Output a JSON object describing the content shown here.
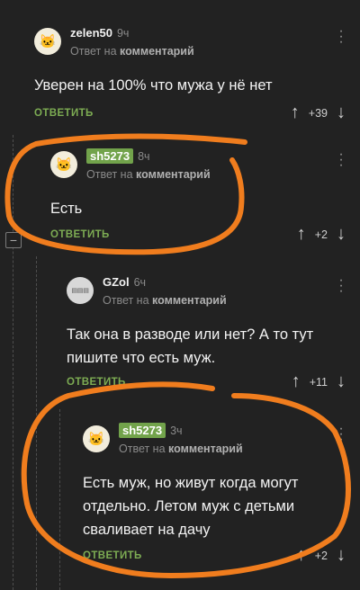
{
  "comments": [
    {
      "username": "zelen50",
      "time": "9ч",
      "reply_prefix": "Ответ на",
      "reply_target": "комментарий",
      "text": "Уверен на 100% что мужа у нё нет",
      "reply_label": "ОТВЕТИТЬ",
      "votes": "+39"
    },
    {
      "username": "sh5273",
      "time": "8ч",
      "reply_prefix": "Ответ на",
      "reply_target": "комментарий",
      "text": "Есть",
      "reply_label": "ОТВЕТИТЬ",
      "votes": "+2"
    },
    {
      "username": "GZol",
      "time": "6ч",
      "reply_prefix": "Ответ на",
      "reply_target": "комментарий",
      "text": "Так она в разводе или нет? А то тут пишите что есть муж.",
      "reply_label": "ОТВЕТИТЬ",
      "votes": "+11"
    },
    {
      "username": "sh5273",
      "time": "3ч",
      "reply_prefix": "Ответ на",
      "reply_target": "комментарий",
      "text": "Есть муж, но живут когда могут отдельно. Летом муж с детьми сваливает на дачу",
      "reply_label": "ОТВЕТИТЬ",
      "votes": "+2"
    }
  ],
  "icons": {
    "more": "vertical-ellipsis",
    "upvote": "up-arrow",
    "downvote": "down-arrow",
    "collapse": "minus-square"
  },
  "glyphs": {
    "avatar": "🐱",
    "collapse": "−",
    "up": "↑",
    "down": "↓"
  },
  "colors": {
    "background": "#222222",
    "accent_green": "#7dac53",
    "highlight_badge": "#72a34b",
    "annotation_orange": "#f07d1e"
  }
}
